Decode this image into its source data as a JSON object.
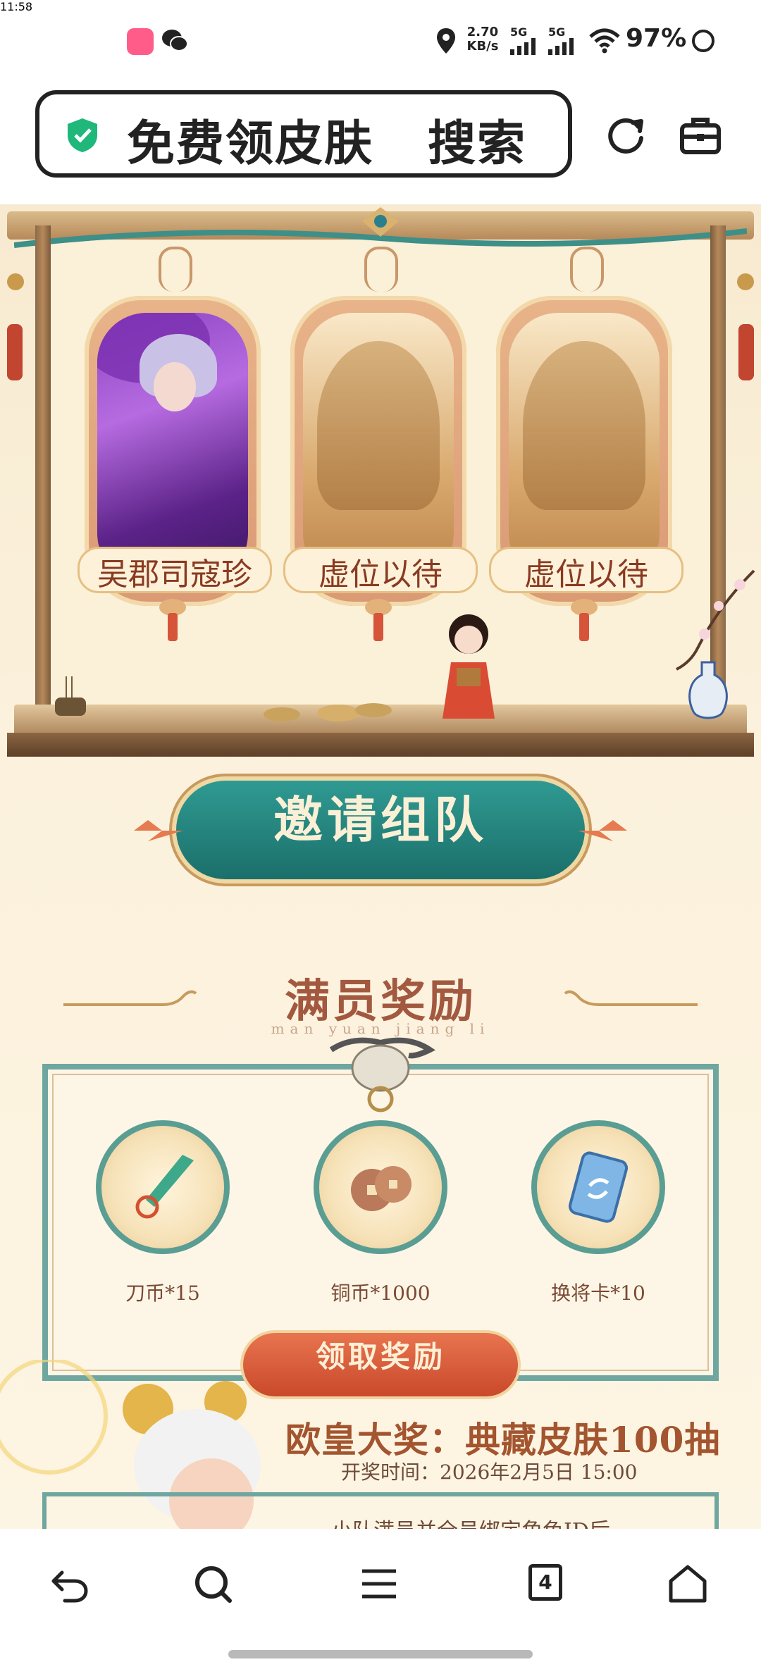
{
  "status_bar": {
    "time": "11:58",
    "net_speed_value": "2.70",
    "net_speed_unit": "KB/s",
    "sim1": "5G",
    "sim2": "5G",
    "battery": "97%"
  },
  "browser": {
    "url_text": "免费领皮肤   搜索"
  },
  "heroes": [
    {
      "label": "吴郡司寇珍"
    },
    {
      "label": "虚位以待"
    },
    {
      "label": "虚位以待"
    }
  ],
  "invite_button": "邀请组队",
  "full_reward": {
    "title": "满员奖励",
    "pinyin": "man  yuan  jiang  li",
    "items": [
      {
        "label": "刀币*15",
        "icon": "jade-blade-icon"
      },
      {
        "label": "铜币*1000",
        "icon": "copper-coins-icon"
      },
      {
        "label": "换将卡*10",
        "icon": "swap-card-icon"
      }
    ],
    "claim_button": "领取奖励"
  },
  "grand_prize": {
    "title": "欧皇大奖：典藏皮肤100抽",
    "draw_time": "开奖时间：2026年2月5日 15:00",
    "partial_text": "小队满员并全员绑定角色ID后"
  },
  "bottom_nav": {
    "tab_count": "4"
  },
  "colors": {
    "teal": "#1b6f6a",
    "claim_red": "#c9492b",
    "title_brown": "#a2593f"
  }
}
